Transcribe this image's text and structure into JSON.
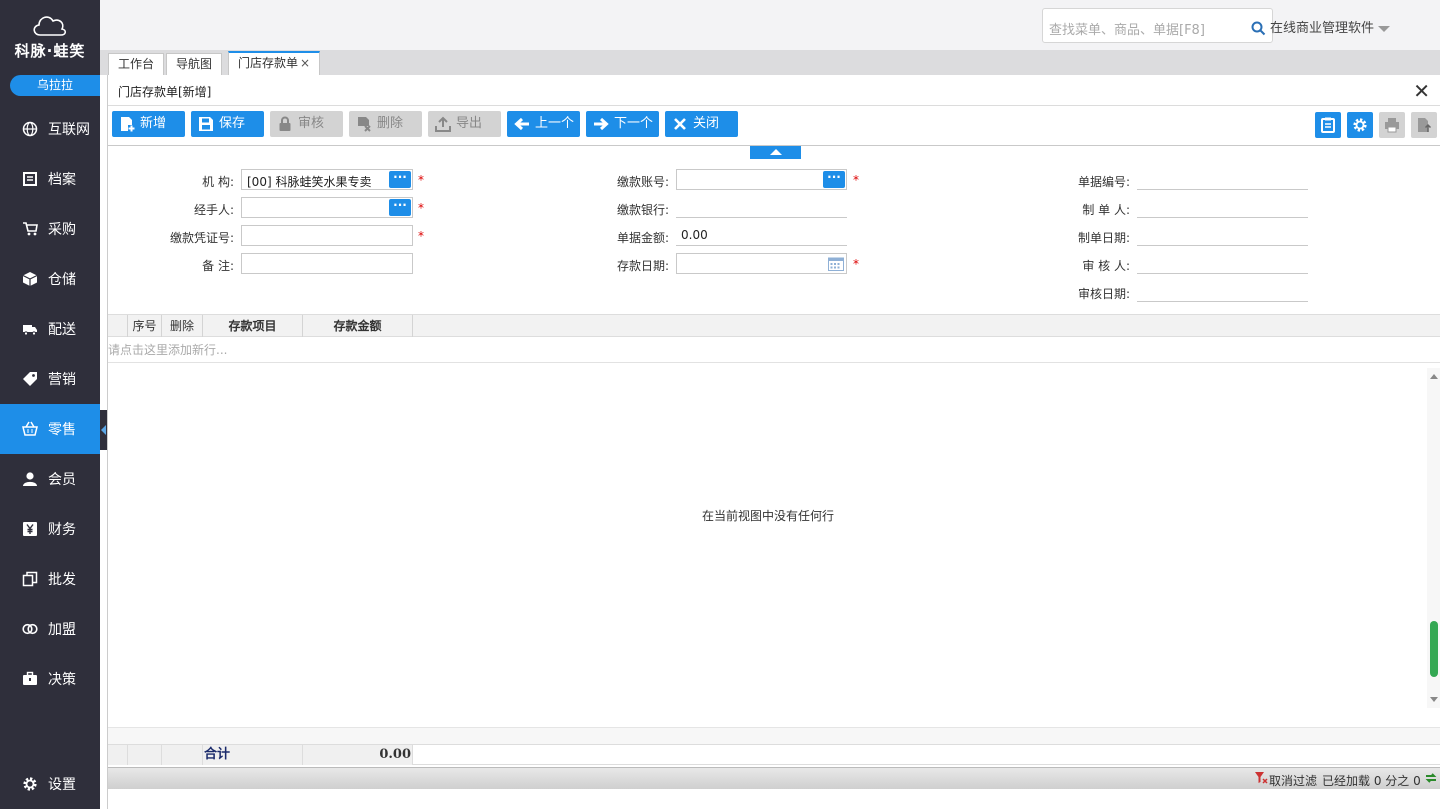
{
  "brand": {
    "name": "科脉·蛙笑",
    "store": "乌拉拉"
  },
  "nav": [
    {
      "label": "互联网",
      "icon": "globe-icon"
    },
    {
      "label": "档案",
      "icon": "archive-icon"
    },
    {
      "label": "采购",
      "icon": "cart-icon"
    },
    {
      "label": "仓储",
      "icon": "box-icon"
    },
    {
      "label": "配送",
      "icon": "truck-icon"
    },
    {
      "label": "营销",
      "icon": "tag-icon"
    },
    {
      "label": "零售",
      "icon": "basket-icon"
    },
    {
      "label": "会员",
      "icon": "user-icon"
    },
    {
      "label": "财务",
      "icon": "yen-icon"
    },
    {
      "label": "批发",
      "icon": "copy-icon"
    },
    {
      "label": "加盟",
      "icon": "link-icon"
    },
    {
      "label": "决策",
      "icon": "briefcase-icon"
    }
  ],
  "settings_label": "设置",
  "search": {
    "placeholder": "查找菜单、商品、单据[F8]"
  },
  "app_title": "在线商业管理软件",
  "tabs": [
    {
      "label": "工作台"
    },
    {
      "label": "导航图"
    },
    {
      "label": "门店存款单"
    }
  ],
  "tab_close": "×",
  "panel": {
    "title": "门店存款单[新增]"
  },
  "toolbar": {
    "new": "新增",
    "save": "保存",
    "audit": "审核",
    "delete": "删除",
    "export": "导出",
    "prev": "上一个",
    "next": "下一个",
    "close": "关闭"
  },
  "form": {
    "org_label": "机  构:",
    "org_value": "[00] 科脉蛙笑水果专卖",
    "handler_label": "经手人:",
    "handler_value": "",
    "voucher_label": "缴款凭证号:",
    "voucher_value": "",
    "remark_label": "备  注:",
    "remark_value": "",
    "account_label": "缴款账号:",
    "account_value": "",
    "bank_label": "缴款银行:",
    "bank_value": "",
    "amount_label": "单据金额:",
    "amount_value": "0.00",
    "date_label": "存款日期:",
    "date_value": "",
    "docno_label": "单据编号:",
    "docno_value": "",
    "maker_label": "制 单 人:",
    "maker_value": "",
    "makedate_label": "制单日期:",
    "makedate_value": "",
    "auditor_label": "审 核 人:",
    "auditor_value": "",
    "auditdate_label": "审核日期:",
    "auditdate_value": "",
    "required_mark": "*",
    "dots": "···"
  },
  "grid": {
    "columns": [
      "序号",
      "删除",
      "存款项目",
      "存款金额"
    ],
    "add_row_hint": "请点击这里添加新行...",
    "empty_text": "在当前视图中没有任何行",
    "total_label": "合计",
    "total_amount": "0.00"
  },
  "status": {
    "cancel_filter": "取消过滤",
    "loaded": "已经加载 0 分之 0"
  }
}
